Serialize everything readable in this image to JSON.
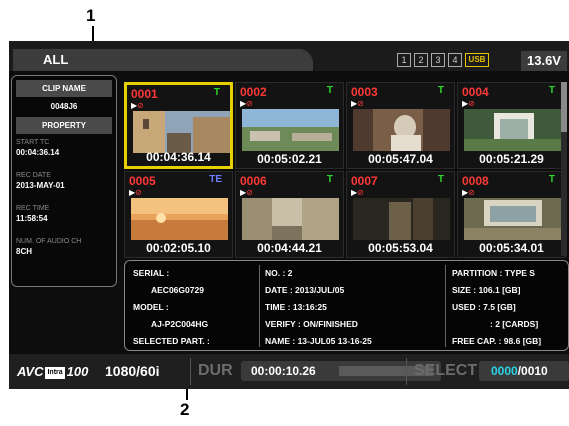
{
  "callouts": [
    "1",
    "2"
  ],
  "top_bar": {
    "tab_label": "ALL",
    "slots": [
      "1",
      "2",
      "3",
      "4",
      "USB"
    ],
    "voltage": "13.6V"
  },
  "side_panel": {
    "clip_name_header": "CLIP NAME",
    "clip_name": "0048J6",
    "property_header": "PROPERTY",
    "fields": [
      {
        "label": "START TC",
        "value": "00:04:36.14"
      },
      {
        "label": "REC DATE",
        "value": "2013-MAY-01"
      },
      {
        "label": "REC TIME",
        "value": "11:58:54"
      },
      {
        "label": "NUM. OF AUDIO CH",
        "value": "8CH"
      }
    ]
  },
  "thumbnails": [
    {
      "number": "0001",
      "format": "T",
      "timecode": "00:04:36.14",
      "selected": true,
      "scene": "street"
    },
    {
      "number": "0002",
      "format": "T",
      "timecode": "00:05:02.21",
      "selected": false,
      "scene": "aerial"
    },
    {
      "number": "0003",
      "format": "T",
      "timecode": "00:05:47.04",
      "selected": false,
      "scene": "person"
    },
    {
      "number": "0004",
      "format": "T",
      "timecode": "00:05:21.29",
      "selected": false,
      "scene": "garden"
    },
    {
      "number": "0005",
      "format": "TE",
      "timecode": "00:02:05.10",
      "selected": false,
      "scene": "sunset"
    },
    {
      "number": "0006",
      "format": "T",
      "timecode": "00:04:44.21",
      "selected": false,
      "scene": "alley"
    },
    {
      "number": "0007",
      "format": "T",
      "timecode": "00:05:53.04",
      "selected": false,
      "scene": "dark"
    },
    {
      "number": "0008",
      "format": "T",
      "timecode": "00:05:34.01",
      "selected": false,
      "scene": "courtyard"
    }
  ],
  "thumb_icons": {
    "play": "▶",
    "ban": "⊘"
  },
  "info_panel": {
    "col1": [
      "SERIAL :",
      "AEC06G0729",
      "MODEL :",
      "AJ-P2C004HG",
      "SELECTED PART. :"
    ],
    "col2": [
      "NO. : 2",
      "DATE : 2013/JUL/05",
      "TIME : 13:16:25",
      "VERIFY : ON/FINISHED",
      "NAME : 13-JUL05 13-16-25"
    ],
    "col3": [
      "PARTITION : TYPE S",
      "SIZE : 106.1 [GB]",
      "USED :   7.5 [GB]",
      ": 2 [CARDS]",
      "FREE CAP. :  98.6 [GB]"
    ]
  },
  "bottom_bar": {
    "codec_a": "AVC",
    "codec_box": "Intra",
    "codec_b": "100",
    "format": "1080/60i",
    "dur_label": "DUR",
    "dur_value": "00:00:10.26",
    "select_label": "SELECT",
    "select_count": "0000",
    "select_total": "/0010"
  },
  "colors": {
    "accent_yellow": "#e6d000",
    "clip_number_red": "#ff3838",
    "format_green": "#2dd62d",
    "select_cyan": "#2ad4e6"
  }
}
